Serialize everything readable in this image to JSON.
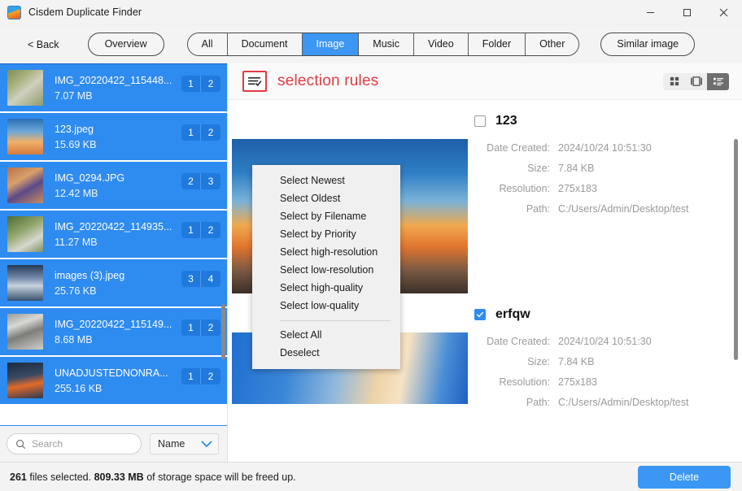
{
  "window": {
    "title": "Cisdem Duplicate Finder",
    "app_icon": "app-logo-icon",
    "minimize": "minimize-icon",
    "maximize": "maximize-icon",
    "close": "close-icon"
  },
  "toolbar": {
    "back_label": "< Back",
    "overview_label": "Overview",
    "similar_image_label": "Similar image",
    "tabs": [
      {
        "label": "All",
        "active": false
      },
      {
        "label": "Document",
        "active": false
      },
      {
        "label": "Image",
        "active": true
      },
      {
        "label": "Music",
        "active": false
      },
      {
        "label": "Video",
        "active": false
      },
      {
        "label": "Folder",
        "active": false
      },
      {
        "label": "Other",
        "active": false
      }
    ]
  },
  "sidebar": {
    "rows": [
      {
        "name": "IMG_20220422_115448...",
        "size": "7.07 MB",
        "count_left": "1",
        "count_right": "2",
        "thumb": "th-road"
      },
      {
        "name": "123.jpeg",
        "size": "15.69 KB",
        "count_left": "1",
        "count_right": "2",
        "thumb": "th-tower"
      },
      {
        "name": "IMG_0294.JPG",
        "size": "12.42 MB",
        "count_left": "2",
        "count_right": "3",
        "thumb": "th-person"
      },
      {
        "name": "IMG_20220422_114935...",
        "size": "11.27 MB",
        "count_left": "1",
        "count_right": "2",
        "thumb": "th-stone"
      },
      {
        "name": "images (3).jpeg",
        "size": "25.76 KB",
        "count_left": "3",
        "count_right": "4",
        "thumb": "th-night"
      },
      {
        "name": "IMG_20220422_115149...",
        "size": "8.68 MB",
        "count_left": "1",
        "count_right": "2",
        "thumb": "th-grey"
      },
      {
        "name": "UNADJUSTEDNONRA...",
        "size": "255.16 KB",
        "count_left": "1",
        "count_right": "2",
        "thumb": "th-fire"
      }
    ],
    "search_placeholder": "Search",
    "search_value": "",
    "search_icon": "search-icon",
    "sort_value": "Name",
    "sort_chevron": "chevron-down-icon"
  },
  "main": {
    "rules_icon": "selection-rules-list-icon",
    "rules_title": "selection rules",
    "view_modes": [
      {
        "icon": "grid-view-icon",
        "active": false
      },
      {
        "icon": "carousel-view-icon",
        "active": false
      },
      {
        "icon": "list-view-icon",
        "active": true
      }
    ],
    "files": [
      {
        "title": "123",
        "checked": false,
        "preview": "p1",
        "meta": [
          {
            "label": "Date Created:",
            "value": "2024/10/24 10:51:30"
          },
          {
            "label": "Size:",
            "value": "7.84 KB"
          },
          {
            "label": "Resolution:",
            "value": "275x183"
          },
          {
            "label": "Path:",
            "value": "C:/Users/Admin/Desktop/test"
          }
        ]
      },
      {
        "title": "erfqw",
        "checked": true,
        "preview": "p2",
        "meta": [
          {
            "label": "Date Created:",
            "value": "2024/10/24 10:51:30"
          },
          {
            "label": "Size:",
            "value": "7.84 KB"
          },
          {
            "label": "Resolution:",
            "value": "275x183"
          },
          {
            "label": "Path:",
            "value": "C:/Users/Admin/Desktop/test"
          }
        ]
      }
    ]
  },
  "menu": {
    "groups": [
      [
        "Select Newest",
        "Select Oldest",
        "Select by Filename",
        "Select by Priority",
        "Select high-resolution",
        "Select low-resolution",
        "Select high-quality",
        "Select low-quality"
      ],
      [
        "Select All",
        "Deselect"
      ]
    ]
  },
  "status": {
    "count": "261",
    "files_selected_text": "files selected.",
    "freed_size": "809.33 MB",
    "freed_text": "of storage space will be freed up.",
    "delete_label": "Delete"
  },
  "colors": {
    "accent_blue": "#3b97f3",
    "sidebar_selected": "#2e8bf0",
    "rules_red": "#e03b42",
    "badge_blue": "#2079dd"
  }
}
